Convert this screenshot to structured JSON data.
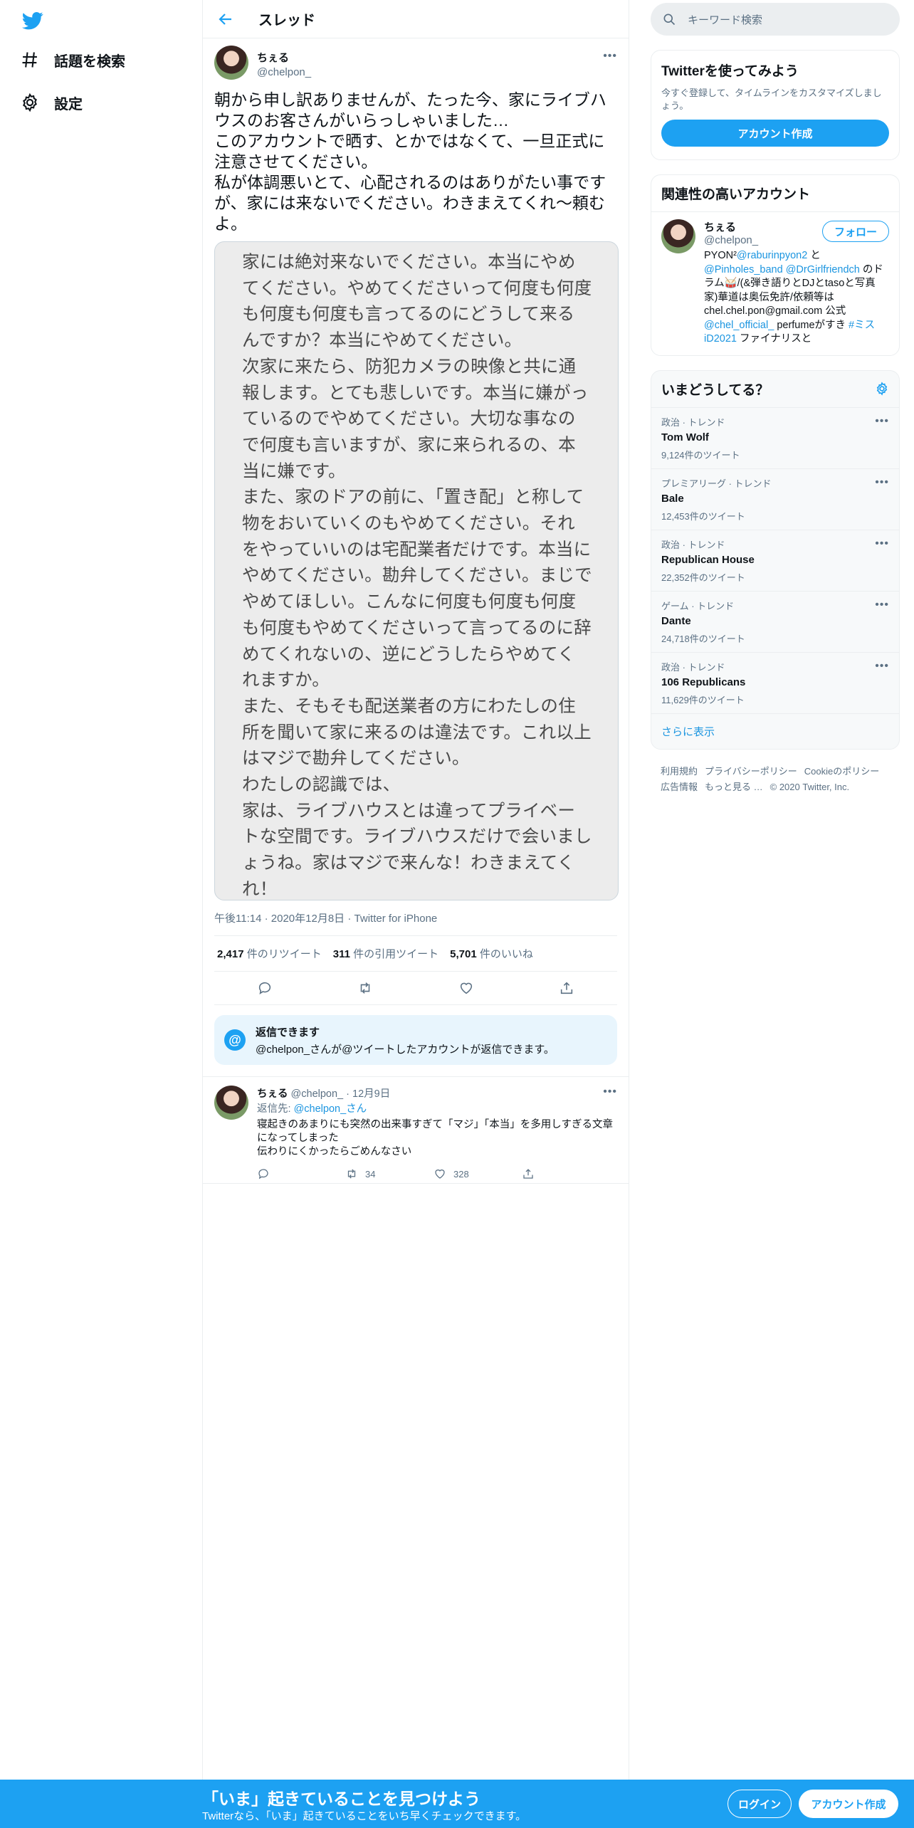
{
  "nav": {
    "logo_icon": "twitter-bird-icon",
    "explore_label": "話題を検索",
    "settings_label": "設定"
  },
  "header": {
    "title": "スレッド"
  },
  "tweet": {
    "author_name": "ちぇる",
    "author_handle": "@chelpon_",
    "text": "朝から申し訳ありませんが、たった今、家にライブハウスのお客さんがいらっしゃいました…\nこのアカウントで晒す、とかではなくて、一旦正式に注意させてください。\n私が体調悪いとて、心配されるのはありがたい事ですが、家には来ないでください。わきまえてくれ〜頼むよ。",
    "image_text": "家には絶対来ないでください。本当にやめてください。やめてくださいって何度も何度も何度も何度も言ってるのにどうして来るんですか？本当にやめてください。\n次家に来たら、防犯カメラの映像と共に通報します。とても悲しいです。本当に嫌がっているのでやめてください。大切な事なので何度も言いますが、家に来られるの、本当に嫌です。\nまた、家のドアの前に、「置き配」と称して物をおいていくのもやめてください。それをやっていいのは宅配業者だけです。本当にやめてください。勘弁してください。まじでやめてほしい。こんなに何度も何度も何度も何度もやめてくださいって言ってるのに辞めてくれないの、逆にどうしたらやめてくれますか。\nまた、そもそも配送業者の方にわたしの住所を聞いて家に来るのは違法です。これ以上はマジで勘弁してください。\nわたしの認識では、\n家は、ライブハウスとは違ってプライベートな空間です。ライブハウスだけで会いましょうね。家はマジで来んな！わきまえてくれ！\n以上、よろしくおねがいします。",
    "time": "午後11:14",
    "date": "2020年12月8日",
    "source": "Twitter for iPhone",
    "retweets": "2,417",
    "retweets_label": "件のリツイート",
    "quotes": "311",
    "quotes_label": "件の引用ツイート",
    "likes": "5,701",
    "likes_label": "件のいいね"
  },
  "reply_notice": {
    "title": "返信できます",
    "body": "@chelpon_さんが@ツイートしたアカウントが返信できます。"
  },
  "reply": {
    "author_name": "ちぇる",
    "author_handle": "@chelpon_",
    "date": "12月9日",
    "reply_to_label": "返信先:",
    "reply_to_handle": "@chelpon_さん",
    "text": "寝起きのあまりにも突然の出来事すぎて「マジ」「本当」を多用しすぎる文章になってしまった\n伝わりにくかったらごめんなさい",
    "retweets": "34",
    "likes": "328"
  },
  "search": {
    "placeholder": "キーワード検索"
  },
  "signup": {
    "title": "Twitterを使ってみよう",
    "desc": "今すぐ登録して、タイムラインをカスタマイズしましょう。",
    "button": "アカウント作成"
  },
  "related": {
    "title": "関連性の高いアカウント",
    "name": "ちぇる",
    "handle": "@chelpon_",
    "follow": "フォロー",
    "bio_parts": [
      "PYON²",
      "@raburinpyon2",
      " と ",
      "@Pinholes_band",
      " ",
      "@DrGirlfriendch",
      " のドラム🥁/(&弾き語りとDJとtasoと写真家)華道は奥伝免許/依頼等は chel.chel.pon@gmail.com 公式 ",
      "@chel_official_",
      " perfumeがすき ",
      "#ミスiD2021",
      " ファイナリスと"
    ]
  },
  "trends": {
    "title": "いまどうしてる？",
    "items": [
      {
        "category": "政治 · トレンド",
        "name": "Tom Wolf",
        "count": "9,124件のツイート"
      },
      {
        "category": "プレミアリーグ · トレンド",
        "name": "Bale",
        "count": "12,453件のツイート"
      },
      {
        "category": "政治 · トレンド",
        "name": "Republican House",
        "count": "22,352件のツイート"
      },
      {
        "category": "ゲーム · トレンド",
        "name": "Dante",
        "count": "24,718件のツイート"
      },
      {
        "category": "政治 · トレンド",
        "name": "106 Republicans",
        "count": "11,629件のツイート"
      }
    ],
    "show_more": "さらに表示"
  },
  "footer": {
    "links": [
      "利用規約",
      "プライバシーポリシー",
      "Cookieのポリシー",
      "広告情報",
      "もっと見る …",
      "© 2020 Twitter, Inc."
    ]
  },
  "bottom_bar": {
    "headline": "「いま」起きていることを見つけよう",
    "sub": "Twitterなら、「いま」起きていることをいち早くチェックできます。",
    "login": "ログイン",
    "signup": "アカウント作成"
  },
  "colors": {
    "accent": "#1da1f2",
    "link": "#1b95e0",
    "muted": "#5b7083"
  }
}
